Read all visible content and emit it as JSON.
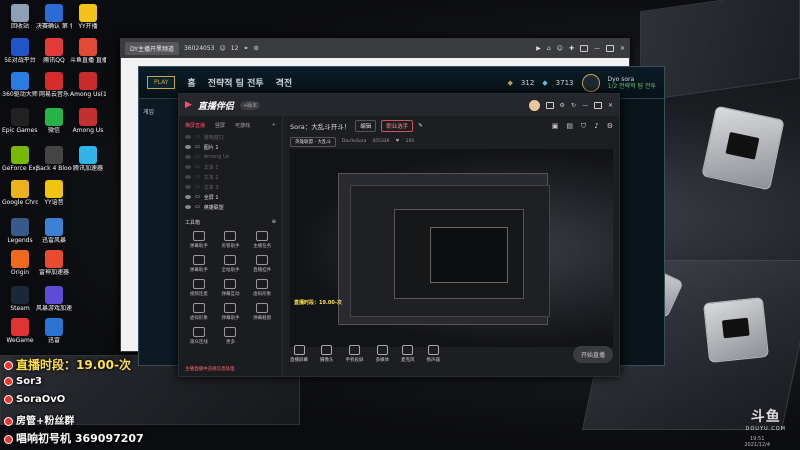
{
  "desktop": {
    "icons": [
      {
        "label": "回收站",
        "color": "#8fa0b6"
      },
      {
        "label": "决赛确认 第 色们要的等",
        "color": "#2a6cd4"
      },
      {
        "label": "YY开播",
        "color": "#f5c21b"
      },
      {
        "label": "5E对战平台",
        "color": "#1f55c8"
      },
      {
        "label": "腾讯QQ",
        "color": "#e33b3b"
      },
      {
        "label": "斗鱼直播 直播伴侣",
        "color": "#e34a35"
      },
      {
        "label": "360驱动大师",
        "color": "#2a7de1"
      },
      {
        "label": "网易云音乐",
        "color": "#d62b2b"
      },
      {
        "label": "Among Us(1)",
        "color": "#c92a2a"
      },
      {
        "label": "Epic Games Launcher",
        "color": "#222222"
      },
      {
        "label": "微信",
        "color": "#27b348"
      },
      {
        "label": "Among Us",
        "color": "#c33030"
      },
      {
        "label": "GeForce Experience",
        "color": "#76b900"
      },
      {
        "label": "Back 4 Blood Beta",
        "color": "#444444"
      },
      {
        "label": "腾讯加速器",
        "color": "#2fb3e8"
      },
      {
        "label": "Google Chrome",
        "color": "#e9b21e"
      },
      {
        "label": "YY语音",
        "color": "#f1c40f"
      },
      {
        "label": "Legends",
        "color": "#375a8a"
      },
      {
        "label": "迅雷风暴",
        "color": "#3b82d6"
      },
      {
        "label": "Origin",
        "color": "#f06a1d"
      },
      {
        "label": "雷神加速器",
        "color": "#e94b2e"
      },
      {
        "label": "Steam",
        "color": "#1b2838"
      },
      {
        "label": "风暴游戏加速器",
        "color": "#5f4bd6"
      },
      {
        "label": "WeGame",
        "color": "#e03434"
      },
      {
        "label": "迅雷",
        "color": "#2b74d1"
      }
    ]
  },
  "overlay": {
    "schedule": "直播时段：19.00-次",
    "line2": "Sor3",
    "line3": "SoraOvO",
    "line4": "房管+粉丝群",
    "line5": "唱响初号机 369097207"
  },
  "browser": {
    "tab_title": "DY主播开黑频道",
    "tab_count": "36024053",
    "tab_num": "12"
  },
  "lol_client": {
    "nav_home": "홈",
    "nav_tft": "전략적 팀 전투",
    "nav_collection": "격전",
    "side_label": "게임",
    "rp": "312",
    "be": "3713",
    "profile_name": "Dyo sora",
    "profile_sub": "1/2 전략적 팀 전투"
  },
  "zb": {
    "brand": "直播伴侣",
    "version": "+版本",
    "left_tabs": [
      "横屏直播",
      "竖屏",
      "可游戏"
    ],
    "sources": [
      {
        "label": "游戏窗口",
        "dim": true
      },
      {
        "label": "图片 1",
        "dim": false
      },
      {
        "label": "Among Us",
        "dim": true
      },
      {
        "label": "文本 1",
        "dim": true
      },
      {
        "label": "文本 2",
        "dim": true
      },
      {
        "label": "文本 3",
        "dim": true
      },
      {
        "label": "全屏 1",
        "dim": false
      },
      {
        "label": "英雄联盟",
        "dim": false
      }
    ],
    "tools_title": "工具箱",
    "tools": [
      "弹幕助手",
      "房管助手",
      "主播任务",
      "弹幕助手",
      "全站助手",
      "直播挂件",
      "视频连麦",
      "弹幕互动",
      "虚拟形象",
      "虚拟形象",
      "弹幕助手",
      "弹幕截图",
      "观众连线",
      "更多"
    ],
    "footer_note": "主播直播中违规信息处理",
    "info_title": "Sora：大乱斗开斗！",
    "info_btn1": "编辑",
    "info_btn2": "职业选手",
    "info2_tag": "英雄联盟 - 大乱斗",
    "info2_name": "DouYuSora",
    "info2_id": "455336",
    "info2_fans": "100",
    "bottom_buttons": [
      "直播屏幕",
      "摄像头",
      "手机投屏",
      "多媒体",
      "麦克风",
      "扬声器"
    ],
    "start_btn": "开始直播",
    "status": [
      "上行速率",
      "帧率",
      "CPU",
      "内存",
      "网络"
    ]
  },
  "watermark": {
    "logo": "斗鱼",
    "domain": "DOUYU.COM"
  },
  "clock": {
    "time": "19:51",
    "date": "2021/12/4"
  }
}
